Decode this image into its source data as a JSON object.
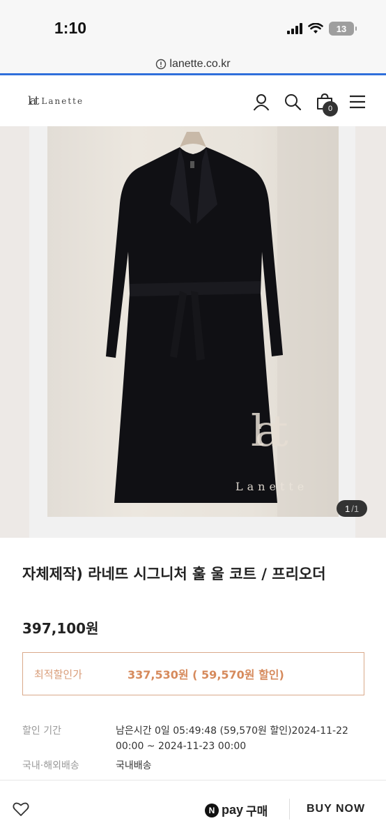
{
  "status_bar": {
    "time": "1:10",
    "battery": "13",
    "icons": [
      "signal-icon",
      "wifi-icon",
      "battery-icon"
    ]
  },
  "browser": {
    "url": "lanette.co.kr",
    "url_icon": "info-icon"
  },
  "header": {
    "logo_mark": "lat",
    "logo_text": "Lanette",
    "icons": [
      "user-icon",
      "search-icon",
      "cart-icon",
      "menu-icon"
    ],
    "cart_count": "0"
  },
  "gallery": {
    "current": "1",
    "separator": "/",
    "total": "1",
    "watermark_mark": "lat",
    "watermark_text": "Lanette"
  },
  "product": {
    "title": "자체제작) 라네뜨 시그니처 훌 울 코트 / 프리오더",
    "price": "397,100원",
    "best_discount_label": "최적할인가",
    "best_discount_value": "337,530원 ( 59,570원 할인)",
    "info": [
      {
        "label": "할인 기간",
        "value": "남은시간 0일 05:49:48 (59,570원 할인)2024-11-22 00:00 ~ 2024-11-23 00:00"
      },
      {
        "label": "국내·해외배송",
        "value": "국내배송"
      }
    ]
  },
  "bottom_bar": {
    "npay_n": "N",
    "npay_label": "pay",
    "npay_buy": "구매",
    "buy_now": "BUY NOW"
  },
  "colors": {
    "accent_blue": "#2f6fdb",
    "discount_border": "#d9a98a",
    "discount_text": "#d68a5c"
  }
}
